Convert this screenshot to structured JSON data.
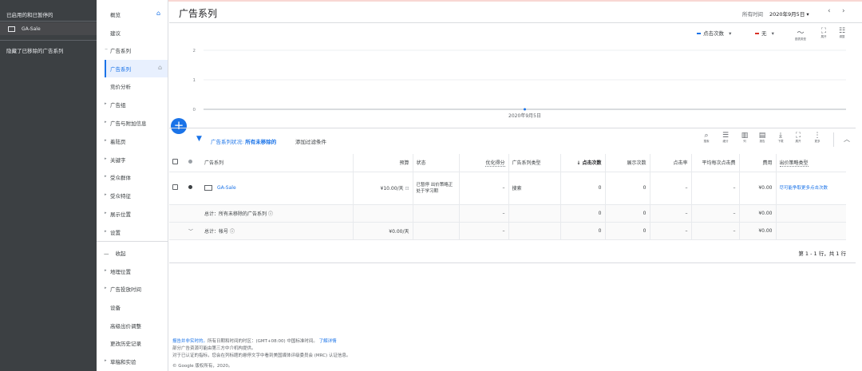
{
  "sidebar": {
    "enabled_paused": "已启用的和已暂停的",
    "account": "GA-Sale",
    "hidden": "隐藏了已移除的广告系列"
  },
  "nav": {
    "overview": "概览",
    "suggestions": "建议",
    "campaigns": "广告系列",
    "campaigns_sub": "广告系列",
    "auction": "竞价分析",
    "adgroups": "广告组",
    "ads_ext": "广告与附加信息",
    "landing": "着陆页",
    "keywords": "关键字",
    "audiences": "受众群体",
    "audience_features": "受众特征",
    "placements": "展示位置",
    "settings": "设置",
    "collapse": "收起",
    "locations": "地理位置",
    "schedule": "广告投放时间",
    "devices": "设备",
    "bid_adjust": "高级出价调整",
    "history": "更改历史记录",
    "drafts": "草稿和实验"
  },
  "header": {
    "title": "广告系列",
    "all_time": "所有时间",
    "date": "2020年9月5日"
  },
  "chart": {
    "metric1": "点击次数",
    "metric2": "无",
    "icon_labels": [
      "图表类型",
      "展开",
      "调整"
    ],
    "accent1": "#1a73e8",
    "accent2": "#d93025"
  },
  "chart_data": {
    "type": "line",
    "x": [
      "2020年9月5日"
    ],
    "series": [
      {
        "name": "点击次数",
        "values": [
          0
        ]
      }
    ],
    "yticks": [
      "2",
      "1",
      "0"
    ],
    "ylim": [
      0,
      2
    ],
    "xlabel": "2020年9月5日"
  },
  "filter": {
    "label": "广告系列状况:",
    "value": "所有未移除的",
    "add": "添加过滤条件"
  },
  "toolbar_icons": [
    "搜索",
    "细分",
    "列",
    "报告",
    "下载",
    "展开",
    "更多"
  ],
  "table": {
    "headers": [
      "广告系列",
      "预算",
      "状态",
      "优化得分",
      "广告系列类型",
      "点击次数",
      "展示次数",
      "点击率",
      "平均每次点击费",
      "费用",
      "出价策略类型"
    ],
    "row": {
      "name": "GA-Sale",
      "budget": "¥10.00/天",
      "status": "已暂停 出价策略正处于学习期",
      "opt": "–",
      "type": "搜索",
      "clicks": "0",
      "impr": "0",
      "ctr": "–",
      "cpc": "–",
      "cost": "¥0.00",
      "bid": "尽可能争取更多点击次数"
    },
    "total1": {
      "label": "总计：所有未移除的广告系列",
      "opt": "–",
      "clicks": "0",
      "impr": "0",
      "ctr": "–",
      "cpc": "–",
      "cost": "¥0.00"
    },
    "total2": {
      "label": "总计：帐号",
      "budget": "¥0.00/天",
      "opt": "–",
      "clicks": "0",
      "impr": "0",
      "ctr": "–",
      "cpc": "–",
      "cost": "¥0.00"
    },
    "pager": "第 1 - 1 行，共 1 行"
  },
  "footer": {
    "line1a": "报告并非实时的。",
    "line1b": "所有日期和时间的时区：(GMT+08:00) 中国标准时间。",
    "line1c": "了解详情",
    "line2": "部分广告资源可能由第三方中介机构提供。",
    "line3": "对于已认证的指标，您会在列标题的悬停文字中看到美国媒体评级委员会 (MRC) 认证信息。",
    "line4": "© Google 版权所有，2020。"
  }
}
